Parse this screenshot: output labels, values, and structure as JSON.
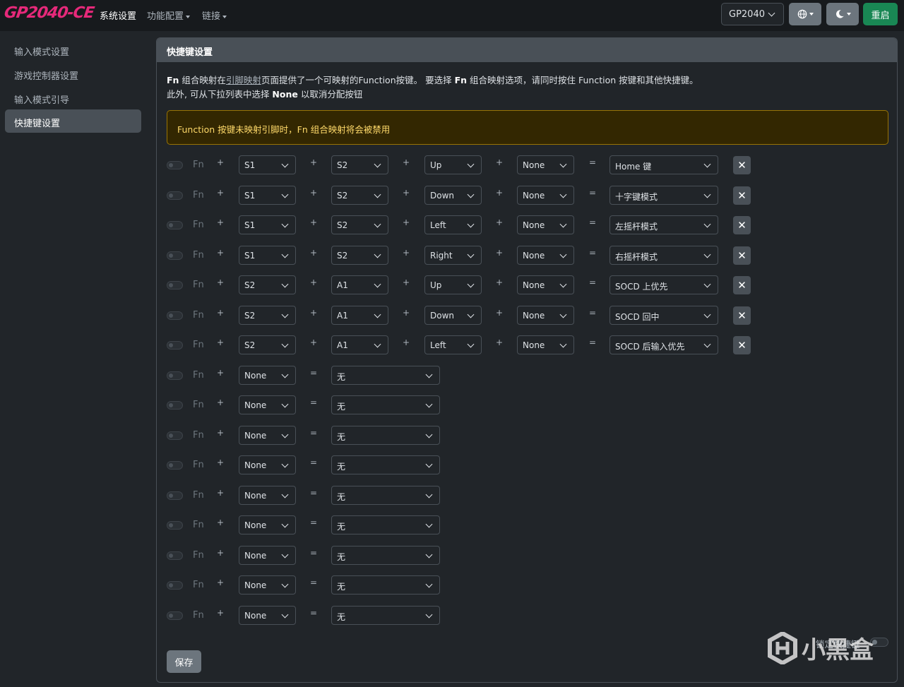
{
  "nav": {
    "brand": "GP2040-CE",
    "links": [
      {
        "label": "系统设置",
        "active": true,
        "dropdown": false
      },
      {
        "label": "功能配置",
        "active": false,
        "dropdown": true
      },
      {
        "label": "链接",
        "active": false,
        "dropdown": true
      }
    ],
    "board": "GP2040",
    "language_icon": "globe-icon",
    "theme_icon": "moon-icon",
    "reboot": "重启",
    "colors": {
      "reboot": "#198754",
      "brand": "#e6297a"
    }
  },
  "sidebar": {
    "items": [
      {
        "label": "输入模式设置",
        "active": false
      },
      {
        "label": "游戏控制器设置",
        "active": false
      },
      {
        "label": "输入模式引导",
        "active": false
      },
      {
        "label": "快捷键设置",
        "active": true
      }
    ]
  },
  "card": {
    "title": "快捷键设置",
    "desc": {
      "fn1": "Fn",
      "t1": " 组合映射在",
      "link": "引脚映射",
      "t2": "页面提供了一个可映射的Function按键。 要选择 ",
      "fn2": "Fn",
      "t3": " 组合映射选项，请同时按住 Function 按键和其他快捷键。",
      "t4": "此外, 可从下拉列表中选择 ",
      "none": "None",
      "t5": " 以取消分配按钮"
    },
    "alert": "Function 按键未映射引脚时，Fn 组合映射将会被禁用",
    "fn_label": "Fn",
    "plus": "+",
    "equals": "=",
    "remove_icon": "close-icon",
    "mapped_hotkeys": [
      {
        "buttons": [
          "S1",
          "S2",
          "Up",
          "None"
        ],
        "action": "Home 键"
      },
      {
        "buttons": [
          "S1",
          "S2",
          "Down",
          "None"
        ],
        "action": "十字键模式"
      },
      {
        "buttons": [
          "S1",
          "S2",
          "Left",
          "None"
        ],
        "action": "左摇杆模式"
      },
      {
        "buttons": [
          "S1",
          "S2",
          "Right",
          "None"
        ],
        "action": "右摇杆模式"
      },
      {
        "buttons": [
          "S2",
          "A1",
          "Up",
          "None"
        ],
        "action": "SOCD 上优先"
      },
      {
        "buttons": [
          "S2",
          "A1",
          "Down",
          "None"
        ],
        "action": "SOCD 回中"
      },
      {
        "buttons": [
          "S2",
          "A1",
          "Left",
          "None"
        ],
        "action": "SOCD 后输入优先"
      }
    ],
    "empty_hotkeys": [
      {
        "button": "None",
        "action": "无"
      },
      {
        "button": "None",
        "action": "无"
      },
      {
        "button": "None",
        "action": "无"
      },
      {
        "button": "None",
        "action": "无"
      },
      {
        "button": "None",
        "action": "无"
      },
      {
        "button": "None",
        "action": "无"
      },
      {
        "button": "None",
        "action": "无"
      },
      {
        "button": "None",
        "action": "无"
      },
      {
        "button": "None",
        "action": "无"
      }
    ],
    "save": "保存",
    "lock_hotkeys": "锁定快捷键"
  },
  "watermark": "小黑盒"
}
